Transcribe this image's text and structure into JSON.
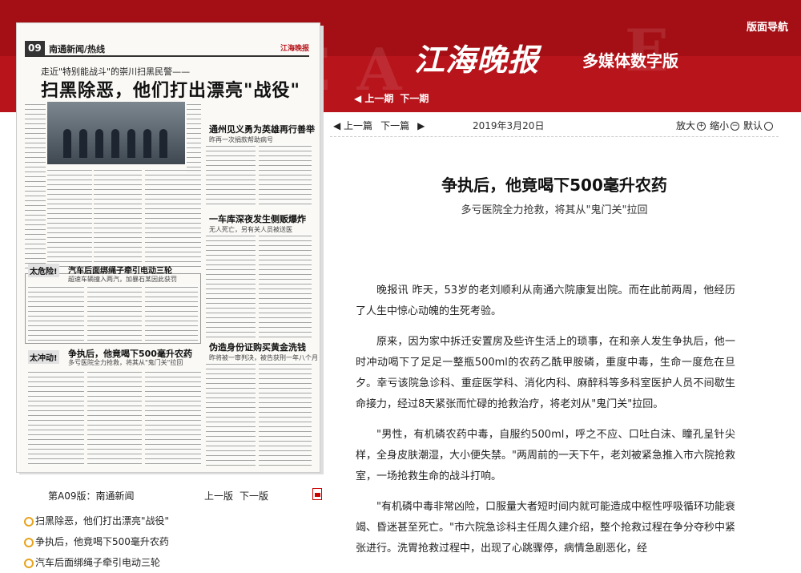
{
  "header": {
    "nav_top": "版面导航",
    "logo": "江海晚报",
    "logo_sub": "多媒体数字版",
    "issue_prev": "上一期",
    "issue_next": "下一期"
  },
  "newspaper_page": {
    "page_num": "09",
    "section": "南通新闻/热线",
    "brand": "江海晚报",
    "kicker": "走近\"特别能战斗\"的崇川扫黑民警——",
    "headline": "扫黑除恶，他们打出漂亮\"战役\"",
    "side_story_1": "通州见义勇为英雄再行善举",
    "side_story_1_sub": "昨再一次捐款帮助病号",
    "side_story_2": "一车库深夜发生侧贩爆炸",
    "side_story_2_sub": "无人死亡，另有关人员被送医",
    "tag_1": "太危险!",
    "tag_1_head": "汽车后面绑绳子牵引电动三轮",
    "tag_1_sub": "超速车辆撞入两汽，加暴石某因此获罚",
    "side_story_3": "伪造身份证购买黄金洗钱",
    "side_story_3_sub": "昨将被一审判决，被告获刑一年八个月",
    "tag_2": "太冲动!",
    "tag_2_head": "争执后，他竟喝下500毫升农药",
    "tag_2_sub": "多亏医院全力抢救，将其从\"鬼门关\"拉回"
  },
  "page_footer": {
    "label": "第A09版：南通新闻",
    "prev": "上一版",
    "next": "下一版"
  },
  "stories": [
    "扫黑除恶，他们打出漂亮\"战役\"",
    "争执后，他竟喝下500毫升农药",
    "汽车后面绑绳子牵引电动三轮"
  ],
  "toolbar": {
    "prev": "上一篇",
    "next": "下一篇",
    "date": "2019年3月20日",
    "zoom_in": "放大",
    "zoom_out": "缩小",
    "zoom_default": "默认"
  },
  "article": {
    "title": "争执后，他竟喝下500毫升农药",
    "subtitle": "多亏医院全力抢救，将其从\"鬼门关\"拉回",
    "paragraphs": [
      "晚报讯 昨天，53岁的老刘顺利从南通六院康复出院。而在此前两周，他经历了人生中惊心动魄的生死考验。",
      "原来，因为家中拆迁安置房及些许生活上的琐事，在和亲人发生争执后，他一时冲动喝下了足足一整瓶500ml的农药乙酰甲胺磷，重度中毒，生命一度危在旦夕。幸亏该院急诊科、重症医学科、消化内科、麻醉科等多科室医护人员不间歇生命接力，经过8天紧张而忙碌的抢救治疗，将老刘从\"鬼门关\"拉回。",
      "\"男性，有机磷农药中毒，自服约500ml，呼之不应、口吐白沫、瞳孔呈针尖样，全身皮肤潮湿，大小便失禁。\"两周前的一天下午，老刘被紧急推入市六院抢救室，一场抢救生命的战斗打响。",
      "\"有机磷中毒非常凶险，口服量大者短时间内就可能造成中枢性呼吸循环功能衰竭、昏迷甚至死亡。\"市六院急诊科主任周久建介绍，整个抢救过程在争分夺秒中紧张进行。洗胃抢救过程中，出现了心跳骤停，病情急剧恶化，经"
    ]
  },
  "colors": {
    "banner_red": "#b8141b",
    "bullet": "#e7a31e"
  }
}
